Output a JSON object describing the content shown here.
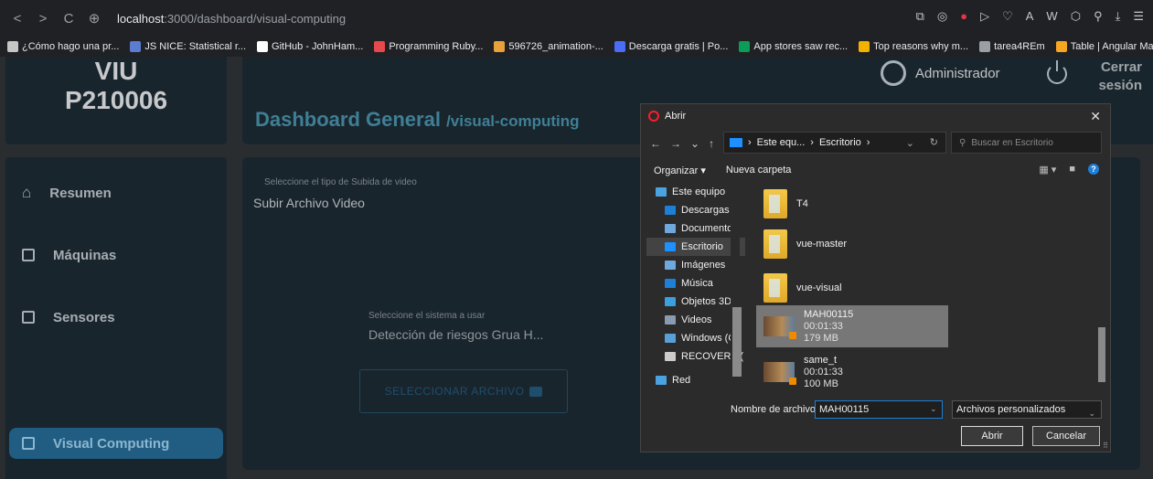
{
  "browser": {
    "url_host": "localhost",
    "url_path": ":3000/dashboard/visual-computing"
  },
  "bookmarks": [
    {
      "label": "¿Cómo hago una pr...",
      "color": "#c4c7c5"
    },
    {
      "label": "JS NICE: Statistical r...",
      "color": "#5b7ccf"
    },
    {
      "label": "GitHub - JohnHam...",
      "color": "#ffffff"
    },
    {
      "label": "Programming Ruby...",
      "color": "#e5484d"
    },
    {
      "label": "596726_animation-...",
      "color": "#e8a23c"
    },
    {
      "label": "Descarga gratis | Po...",
      "color": "#4a6cf7"
    },
    {
      "label": "App stores saw rec...",
      "color": "#0b9d58"
    },
    {
      "label": "Top reasons why m...",
      "color": "#f2b200"
    },
    {
      "label": "tarea4REm",
      "color": "#9aa0a6"
    },
    {
      "label": "Table | Angular Mat...",
      "color": "#f6a623"
    }
  ],
  "app": {
    "logo_line1": "VIU",
    "logo_line2": "P210006",
    "title": "Dashboard General",
    "title_sub": "/visual-computing",
    "user": "Administrador",
    "logout": "Cerrar sesión",
    "sidebar": [
      {
        "label": "Resumen"
      },
      {
        "label": "Máquinas"
      },
      {
        "label": "Sensores"
      },
      {
        "label": "Visual Computing"
      }
    ],
    "upload_label": "Seleccione el tipo de Subida de video",
    "upload_value": "Subir Archivo Video",
    "system_label": "Seleccione el sistema a usar",
    "system_value": "Detección de riesgos Grua H...",
    "select_button": "SELECCIONAR ARCHIVO"
  },
  "dialog": {
    "title": "Abrir",
    "address": [
      "Este equ...",
      "Escritorio"
    ],
    "search_placeholder": "Buscar en Escritorio",
    "organize": "Organizar",
    "new_folder": "Nueva carpeta",
    "tree": [
      {
        "label": "Este equipo",
        "color": "#4aa3df"
      },
      {
        "label": "Descargas",
        "color": "#1e7fd6"
      },
      {
        "label": "Documentos",
        "color": "#6fa8dc"
      },
      {
        "label": "Escritorio",
        "color": "#1e90ff"
      },
      {
        "label": "Imágenes",
        "color": "#6fa8dc"
      },
      {
        "label": "Música",
        "color": "#1e7fd6"
      },
      {
        "label": "Objetos 3D",
        "color": "#3aa0e0"
      },
      {
        "label": "Videos",
        "color": "#8a9bb0"
      },
      {
        "label": "Windows (C:",
        "color": "#5aa0d8"
      },
      {
        "label": "RECOVERY (",
        "color": "#cccccc"
      },
      {
        "label": "Red",
        "color": "#4aa3df"
      }
    ],
    "files": [
      {
        "name": "T4",
        "kind": "folder"
      },
      {
        "name": "vue-master",
        "kind": "folder"
      },
      {
        "name": "vue-visual",
        "kind": "folder"
      },
      {
        "name": "MAH00115",
        "duration": "00:01:33",
        "size": "179 MB",
        "kind": "video"
      },
      {
        "name": "same_t",
        "duration": "00:01:33",
        "size": "100 MB",
        "kind": "video"
      }
    ],
    "filename_label": "Nombre de archivo:",
    "filename_value": "MAH00115",
    "filetype_value": "Archivos personalizados",
    "open_button": "Abrir",
    "cancel_button": "Cancelar"
  }
}
